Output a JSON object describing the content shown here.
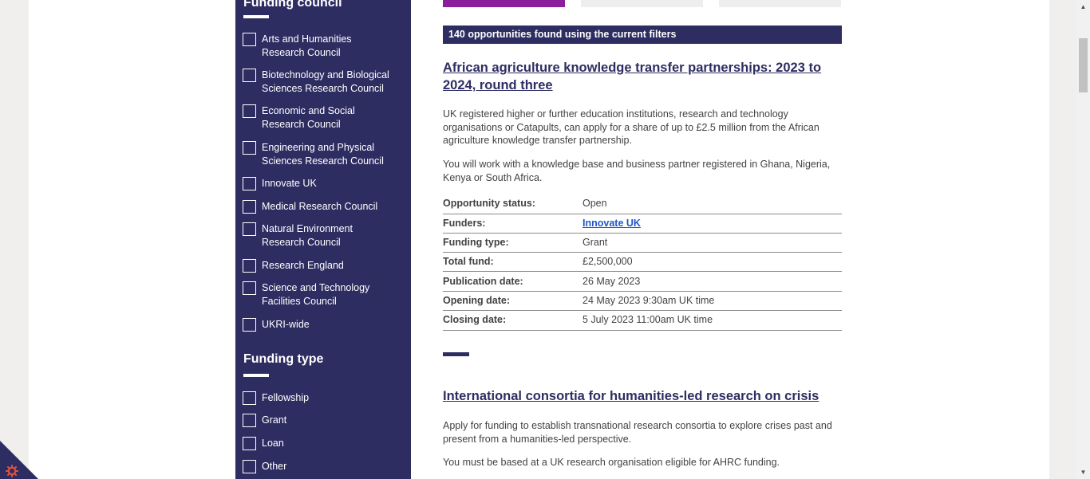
{
  "sidebar": {
    "funding_council": {
      "heading": "Funding council",
      "options": [
        "Arts and Humanities Research Council",
        "Biotechnology and Biological Sciences Research Council",
        "Economic and Social Research Council",
        "Engineering and Physical Sciences Research Council",
        "Innovate UK",
        "Medical Research Council",
        "Natural Environment Research Council",
        "Research England",
        "Science and Technology Facilities Council",
        "UKRI-wide"
      ]
    },
    "funding_type": {
      "heading": "Funding type",
      "options": [
        "Fellowship",
        "Grant",
        "Loan",
        "Other"
      ]
    }
  },
  "results_count": "140 opportunities found using the current filters",
  "opportunities": [
    {
      "title": "African agriculture knowledge transfer partnerships: 2023 to 2024, round three",
      "paragraphs": [
        "UK registered higher or further education institutions, research and technology organisations or Catapults, can apply for a share of up to £2.5 million from the African agriculture knowledge transfer partnership.",
        "You will work with a knowledge base and business partner registered in Ghana, Nigeria, Kenya or South Africa."
      ],
      "details": [
        {
          "label": "Opportunity status:",
          "value": "Open"
        },
        {
          "label": "Funders:",
          "value": "Innovate UK"
        },
        {
          "label": "Funding type:",
          "value": "Grant"
        },
        {
          "label": "Total fund:",
          "value": "£2,500,000"
        },
        {
          "label": "Publication date:",
          "value": "26 May 2023"
        },
        {
          "label": "Opening date:",
          "value": "24 May 2023 9:30am UK time"
        },
        {
          "label": "Closing date:",
          "value": "5 July 2023 11:00am UK time"
        }
      ]
    },
    {
      "title": "International consortia for humanities-led research on crisis",
      "paragraphs": [
        "Apply for funding to establish transnational research consortia to explore crises past and present from a humanities-led perspective.",
        "You must be based at a UK research organisation eligible for AHRC funding."
      ]
    }
  ],
  "colors": {
    "brand_navy": "#2e2d62",
    "tab_active_purple": "#8b1f9b",
    "link_blue": "#1d57c9",
    "cookie_orange": "#e8533a"
  },
  "icons": {
    "scroll_up": "triangle-up",
    "scroll_down": "triangle-down",
    "cookie_settings": "gear"
  }
}
